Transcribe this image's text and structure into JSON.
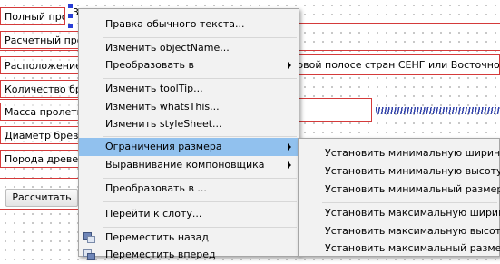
{
  "form": {
    "rows": [
      {
        "label": "Полный пролет"
      },
      {
        "label": "Расчетный пролет"
      },
      {
        "label": "Расположение жел"
      },
      {
        "label": "Количество бревен"
      },
      {
        "label": "Масса пролетного"
      },
      {
        "label": "Диаметр бревна"
      },
      {
        "label": "Порода древесины"
      }
    ],
    "selected_widget_text": "3",
    "region_field_text": "товой полосе стран СЕНГ или Восточной и Западной",
    "calc_button": "Рассчитать"
  },
  "context_menu": {
    "items": [
      {
        "label": "Правка обычного текста..."
      },
      {
        "label": "Изменить objectName..."
      },
      {
        "label": "Преобразовать в"
      },
      {
        "label": "Изменить toolTip..."
      },
      {
        "label": "Изменить whatsThis..."
      },
      {
        "label": "Изменить styleSheet..."
      },
      {
        "label": "Ограничения размера"
      },
      {
        "label": "Выравнивание компоновщика"
      },
      {
        "label": "Преобразовать в ..."
      },
      {
        "label": "Перейти к слоту..."
      },
      {
        "label": "Переместить назад"
      },
      {
        "label": "Переместить вперед"
      }
    ]
  },
  "submenu": {
    "items": [
      {
        "label": "Установить минимальную ширину"
      },
      {
        "label": "Установить минимальную высоту"
      },
      {
        "label": "Установить минимальный размер"
      },
      {
        "label": "Установить максимальную ширину"
      },
      {
        "label": "Установить максимальную высоту"
      },
      {
        "label": "Установить максимальный размер"
      }
    ]
  }
}
